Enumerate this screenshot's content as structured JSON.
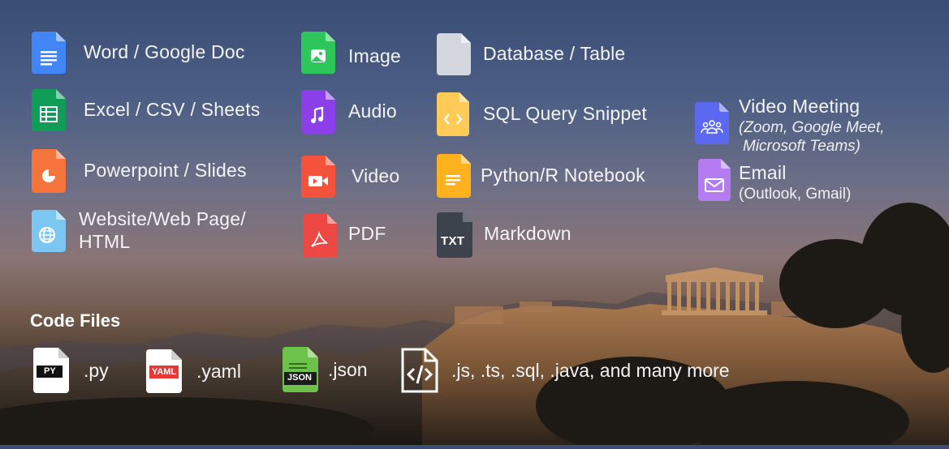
{
  "file_types": [
    {
      "label": "Word / Google Doc",
      "icon": "document-icon",
      "color": "#4285F4"
    },
    {
      "label": "Excel / CSV / Sheets",
      "icon": "spreadsheet-icon",
      "color": "#0F9D58"
    },
    {
      "label": "Powerpoint / Slides",
      "icon": "presentation-icon",
      "color": "#F4743C"
    },
    {
      "label": "Website/Web Page/",
      "label2": "HTML",
      "icon": "globe-icon",
      "color": "#7CC6F2"
    },
    {
      "label": "Image",
      "icon": "image-icon",
      "color": "#2DC65B"
    },
    {
      "label": "Audio",
      "icon": "music-note-icon",
      "color": "#8A3FE8"
    },
    {
      "label": "Video",
      "icon": "video-icon",
      "color": "#F4523B"
    },
    {
      "label": "PDF",
      "icon": "pdf-icon",
      "color": "#EE4844"
    },
    {
      "label": "Database / Table",
      "icon": "database-file-icon",
      "color": "#D4D8DE"
    },
    {
      "label": "SQL Query Snippet",
      "icon": "code-brackets-icon",
      "color": "#FFCB57"
    },
    {
      "label": "Python/R Notebook",
      "icon": "notebook-icon",
      "color": "#FFB21E"
    },
    {
      "label": "Markdown",
      "icon": "txt-file-icon",
      "color": "#3C434D",
      "badge": "TXT"
    },
    {
      "label": "Video Meeting",
      "note": "(Zoom, Google Meet,",
      "note2": "Microsoft Teams)",
      "icon": "people-group-icon",
      "color": "#5B68F0"
    },
    {
      "label": "Email",
      "note": "(Outlook, Gmail)",
      "icon": "mail-icon",
      "color": "#B57BF0"
    }
  ],
  "code_files": {
    "title": "Code Files",
    "items": [
      {
        "label": ".py",
        "badge": "PY",
        "icon": "py-file-icon"
      },
      {
        "label": ".yaml",
        "badge": "YAML",
        "icon": "yaml-file-icon",
        "badge_color": "#E53935"
      },
      {
        "label": ".json",
        "badge": "JSON",
        "icon": "json-file-icon",
        "color": "#6CC24A"
      },
      {
        "label": ".js, .ts, .sql, .java, and many more",
        "icon": "code-file-icon"
      }
    ]
  }
}
